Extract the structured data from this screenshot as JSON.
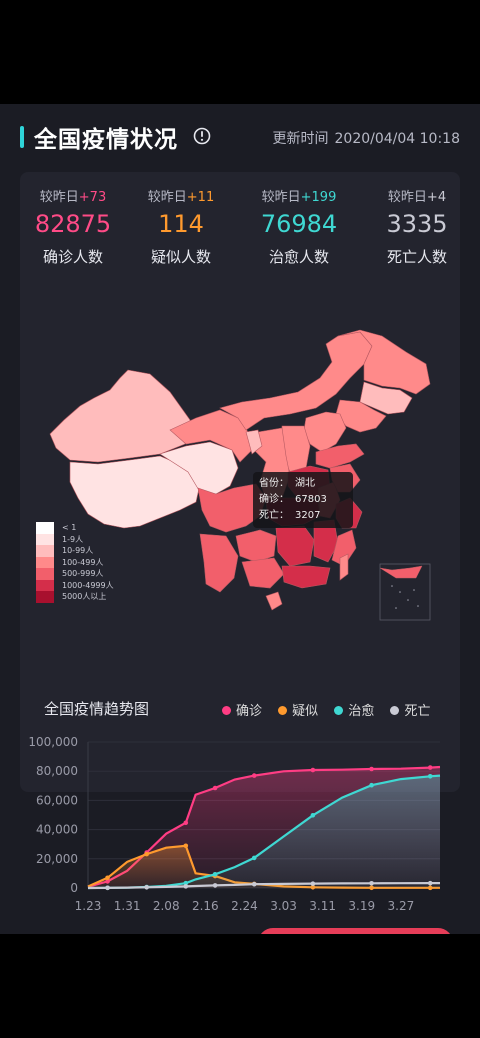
{
  "header": {
    "title": "全国疫情状况",
    "info_icon": "info-circle-icon",
    "update_label": "更新时间",
    "update_time": "2020/04/04 10:18"
  },
  "stats": [
    {
      "delta_label": "较昨日",
      "delta": "+73",
      "value": "82875",
      "label": "确诊人数",
      "color": "#ff4b87",
      "delta_color": "#ff4b87"
    },
    {
      "delta_label": "较昨日",
      "delta": "+11",
      "value": "114",
      "label": "疑似人数",
      "color": "#ff9a2e",
      "delta_color": "#ff9a2e"
    },
    {
      "delta_label": "较昨日",
      "delta": "+199",
      "value": "76984",
      "label": "治愈人数",
      "color": "#3fd8d2",
      "delta_color": "#3fd8d2"
    },
    {
      "delta_label": "较昨日",
      "delta": "+4",
      "value": "3335",
      "label": "死亡人数",
      "color": "#c9cad4",
      "delta_color": "#c9cad4"
    }
  ],
  "map": {
    "tooltip": {
      "province_label": "省份：",
      "province": "湖北",
      "confirmed_label": "确诊：",
      "confirmed": "67803",
      "death_label": "死亡：",
      "death": "3207"
    },
    "legend": [
      {
        "label": "< 1",
        "color": "#ffffff"
      },
      {
        "label": "1-9人",
        "color": "#ffe3e3"
      },
      {
        "label": "10-99人",
        "color": "#ffbcbc"
      },
      {
        "label": "100-499人",
        "color": "#ff8a8a"
      },
      {
        "label": "500-999人",
        "color": "#f25f6b"
      },
      {
        "label": "1000-4999人",
        "color": "#d42e4a"
      },
      {
        "label": "5000人以上",
        "color": "#a8102e"
      }
    ]
  },
  "trend": {
    "title": "全国疫情趋势图",
    "legend": [
      {
        "name": "确诊",
        "color": "#ff3d84"
      },
      {
        "name": "疑似",
        "color": "#ff9a2e"
      },
      {
        "name": "治愈",
        "color": "#3fd8d2"
      },
      {
        "name": "死亡",
        "color": "#c9cad4"
      }
    ]
  },
  "chart_data": {
    "type": "line",
    "title": "全国疫情趋势图",
    "x_ticks": [
      "1.23",
      "1.31",
      "2.08",
      "2.16",
      "2.24",
      "3.03",
      "3.11",
      "3.19",
      "3.27"
    ],
    "y_ticks": [
      "0",
      "20,000",
      "40,000",
      "60,000",
      "80,000",
      "100,000"
    ],
    "ylim": [
      0,
      100000
    ],
    "x": [
      0,
      4,
      8,
      12,
      16,
      20,
      22,
      26,
      30,
      34,
      40,
      46,
      52,
      58,
      64,
      70,
      72
    ],
    "series": [
      {
        "name": "确诊",
        "color": "#ff3d84",
        "values": [
          800,
          4500,
          11800,
          24300,
          37200,
          44700,
          63900,
          68500,
          74300,
          77000,
          79900,
          80800,
          81000,
          81500,
          81700,
          82500,
          82875
        ]
      },
      {
        "name": "疑似",
        "color": "#ff9a2e",
        "values": [
          1000,
          7000,
          17900,
          23200,
          27600,
          28900,
          10100,
          8200,
          3900,
          2800,
          1100,
          500,
          300,
          150,
          120,
          110,
          114
        ]
      },
      {
        "name": "治愈",
        "color": "#3fd8d2",
        "values": [
          30,
          150,
          240,
          680,
          1540,
          3300,
          5900,
          9400,
          14300,
          20600,
          35300,
          49800,
          61900,
          70400,
          74600,
          76500,
          76984
        ]
      },
      {
        "name": "死亡",
        "color": "#c9cad4",
        "values": [
          25,
          100,
          260,
          490,
          720,
          1110,
          1370,
          1770,
          2120,
          2590,
          2830,
          2980,
          3130,
          3250,
          3300,
          3330,
          3335
        ]
      }
    ]
  }
}
